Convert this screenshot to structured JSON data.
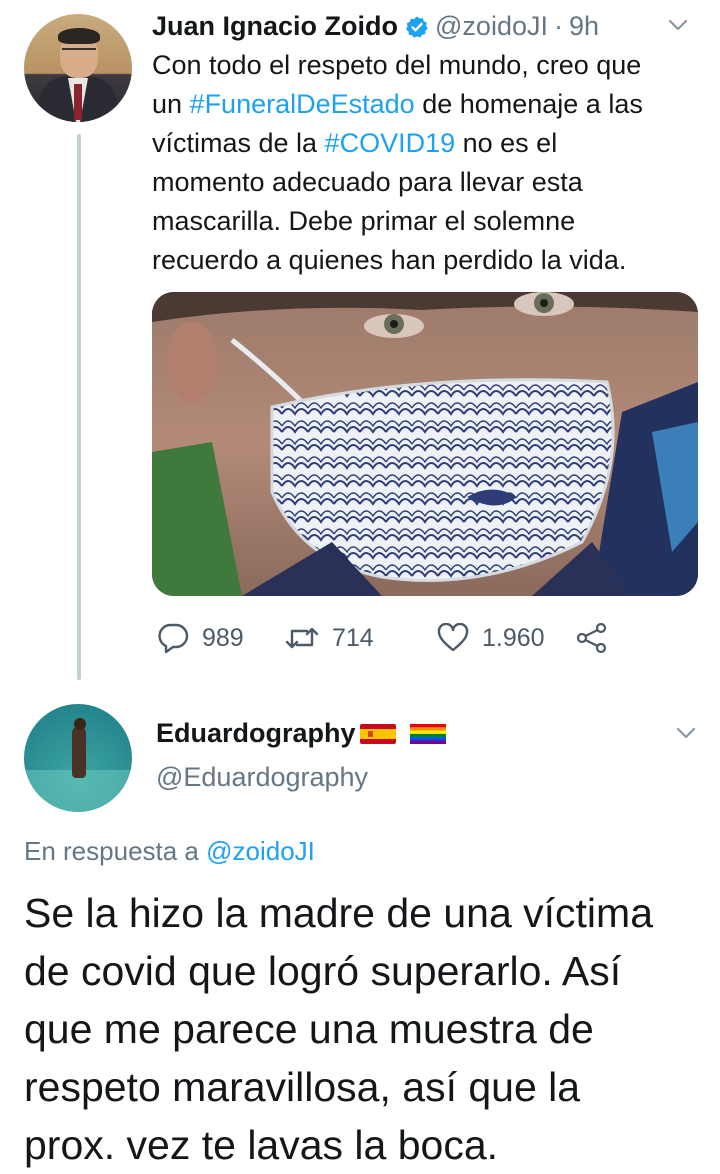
{
  "tweet": {
    "author_name": "Juan Ignacio Zoido",
    "handle": "@zoidoJI",
    "separator": "·",
    "time": "9h",
    "text_lines": [
      [
        {
          "t": "Con todo el respeto del mundo, creo que",
          "h": false
        }
      ],
      [
        {
          "t": "un ",
          "h": false
        },
        {
          "t": "#FuneralDeEstado",
          "h": true
        },
        {
          "t": " de homenaje a las",
          "h": false
        }
      ],
      [
        {
          "t": "víctimas de la ",
          "h": false
        },
        {
          "t": "#COVID19",
          "h": true
        },
        {
          "t": " no es el",
          "h": false
        }
      ],
      [
        {
          "t": "momento adecuado para llevar esta",
          "h": false
        }
      ],
      [
        {
          "t": "mascarilla. Debe primar el solemne",
          "h": false
        }
      ],
      [
        {
          "t": "recuerdo a quienes han perdido la vida.",
          "h": false
        }
      ]
    ],
    "media": {
      "icon": "photo",
      "description": ""
    },
    "replies": "989",
    "retweets": "714",
    "likes": "1.960",
    "icons": {
      "verified": "verified-badge-icon",
      "more": "chevron-down-icon",
      "reply": "reply-bubble-icon",
      "retweet": "retweet-icon",
      "like": "heart-icon",
      "share": "share-icon"
    }
  },
  "reply": {
    "author_name": "Eduardography",
    "flags": [
      "spain-flag",
      "rainbow-flag"
    ],
    "handle": "@Eduardography",
    "reply_prefix": "En respuesta a ",
    "reply_mention": "@zoidoJI",
    "text_lines": [
      "Se la hizo la madre de una víctima",
      "de covid que logró superarlo. Así",
      "que me parece una muestra de",
      "respeto maravillosa, así que la",
      "prox. vez te lavas la boca."
    ]
  },
  "colors": {
    "link": "#1da1f2",
    "secondary": "#657786",
    "text": "#14171a",
    "thread_line": "#c4cfd6"
  }
}
